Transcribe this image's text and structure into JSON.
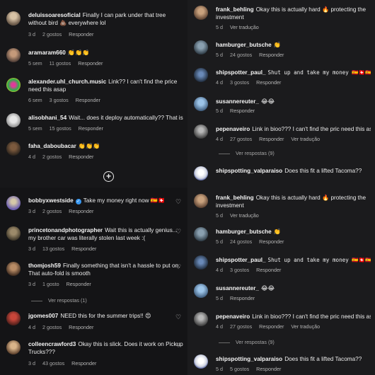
{
  "top_left": {
    "comments": [
      {
        "user": "deluissoaresoficial",
        "text": "Finally I can park under that tree without bird 💩 everywhere lol",
        "age": "3 d",
        "likes": "2 gostos",
        "reply": "Responder"
      },
      {
        "user": "aramaram660",
        "text": "👏👏👏",
        "age": "5 sem",
        "likes": "11 gostos",
        "reply": "Responder"
      },
      {
        "user": "alexander.uhl_church.music",
        "text": "Link?? I can't find the price need this asap",
        "age": "6 sem",
        "likes": "3 gostos",
        "reply": "Responder"
      },
      {
        "user": "alisobhani_54",
        "text": "Wait... does it deploy automatically?? That is",
        "age": "5 sem",
        "likes": "15 gostos",
        "reply": "Responder"
      },
      {
        "user": "faha_daboubacar",
        "text": "👏👏👏",
        "age": "4 d",
        "likes": "2 gostos",
        "reply": "Responder"
      }
    ],
    "plus_icon": "+"
  },
  "top_right": {
    "comments": [
      {
        "user": "frank_behling",
        "text": "Okay this is actually hard 🔥 protecting the investment",
        "age": "5 d",
        "likes": "",
        "reply": "Ver tradução"
      },
      {
        "user": "hamburger_butsche",
        "text": "👏",
        "age": "5 d",
        "likes": "24 gostos",
        "reply": "Responder"
      },
      {
        "user": "shipspotter_paul_",
        "text": "Shut up and take my money 🇪🇸🇨🇭🇪🇸",
        "age": "4 d",
        "likes": "3 gostos",
        "reply": "Responder"
      },
      {
        "user": "susannereuter_",
        "text": "😂😂",
        "age": "5 d",
        "likes": "",
        "reply": "Responder"
      },
      {
        "user": "pepenaveiro",
        "text": "Link in bioo??? I can't find the pric need this asap",
        "age": "4 d",
        "likes": "27 gostos",
        "reply": "Responder",
        "extra": "Ver tradução"
      },
      {
        "user": "shipspotting_valparaiso",
        "text": "Does this fit a lifted Tacoma??",
        "age": "",
        "likes": "",
        "reply": ""
      }
    ],
    "thread": "Ver respostas (9)"
  },
  "bottom_left": {
    "comments": [
      {
        "user": "bobbyxwestside",
        "text": "Take my money right now 🇪🇸🇨🇭",
        "age": "3 d",
        "likes": "2 gostos",
        "reply": "Responder"
      },
      {
        "user": "princetonandphotographer",
        "text": "Wait this is actually genius... my brother car was literally stolen last week :(",
        "age": "3 d",
        "likes": "13 gostos",
        "reply": "Responder"
      },
      {
        "user": "thomjosh59",
        "text": "Finally something that isn't a hassle to put on. That auto-fold is smooth",
        "age": "3 d",
        "likes": "1 gosto",
        "reply": "Responder"
      },
      {
        "user": "jgomes007",
        "text": "NEED this for the summer trips!! 😍",
        "age": "4 d",
        "likes": "2 gostos",
        "reply": "Responder"
      },
      {
        "user": "colleencrawford3",
        "text": "Okay this is slick. Does it work on Pickup Trucks???",
        "age": "3 d",
        "likes": "43 gostos",
        "reply": "Responder"
      }
    ],
    "thread": "Ver respostas (1)"
  },
  "bottom_right": {
    "comments": [
      {
        "user": "frank_behling",
        "text": "Okay this is actually hard 🔥 protecting the investment",
        "age": "5 d",
        "likes": "",
        "reply": "Ver tradução"
      },
      {
        "user": "hamburger_butsche",
        "text": "👏",
        "age": "5 d",
        "likes": "24 gostos",
        "reply": "Responder"
      },
      {
        "user": "shipspotter_paul_",
        "text": "Shut up and take my money 🇪🇸🇨🇭🇪🇸",
        "age": "4 d",
        "likes": "3 gostos",
        "reply": "Responder"
      },
      {
        "user": "susannereuter_",
        "text": "😂😂",
        "age": "5 d",
        "likes": "",
        "reply": "Responder"
      },
      {
        "user": "pepenaveiro",
        "text": "Link in bioo??? I can't find the pric need this asap",
        "age": "4 d",
        "likes": "27 gostos",
        "reply": "Responder",
        "extra": "Ver tradução"
      },
      {
        "user": "shipspotting_valparaiso",
        "text": "Does this fit a lifted Tacoma??",
        "age": "5 d",
        "likes": "5 gostos",
        "reply": "Responder"
      }
    ],
    "thread": "Ver respostas (9)"
  },
  "colors": {
    "background": "#171719",
    "text": "#ececec",
    "meta": "#a8a8a8",
    "verified": "#3897f0"
  }
}
